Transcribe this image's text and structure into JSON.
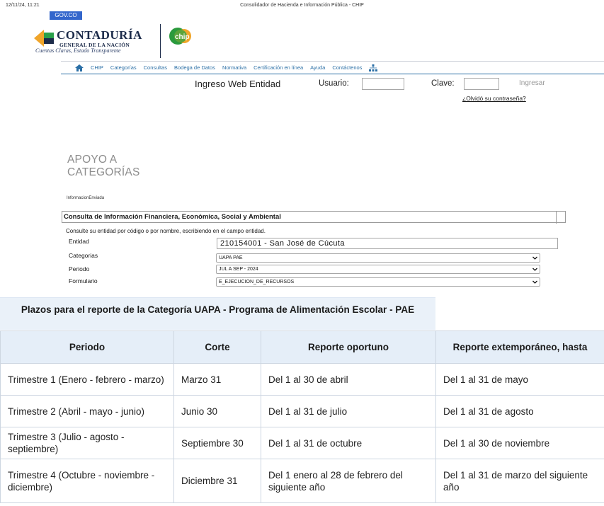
{
  "print_header": {
    "timestamp": "12/11/24, 11:21",
    "page_title": "Consolidador de Hacienda e Información Pública - CHIP"
  },
  "gov_badge": "GOV.CO",
  "logo": {
    "title": "CONTADURÍA",
    "subtitle": "GENERAL DE LA NACIÓN",
    "tagline": "Cuentas Claras, Estado Transparente",
    "chip_text": "chip"
  },
  "nav": {
    "items": [
      "CHIP",
      "Categorías",
      "Consultas",
      "Bodega de Datos",
      "Normativa",
      "Certificación en línea",
      "Ayuda",
      "Contáctenos"
    ],
    "icons": [
      "home-icon",
      "sitemap-icon"
    ],
    "color": "#2b6fa6"
  },
  "login": {
    "title": "Ingreso Web Entidad",
    "user_label": "Usuario:",
    "user_value": "",
    "pass_label": "Clave:",
    "pass_value": "",
    "submit_label": "Ingresar",
    "forgot_label": "¿Olvidó su contraseña?"
  },
  "section": {
    "title_line1": "APOYO A",
    "title_line2": "CATEGORÍAS",
    "info_label": "InformacionEnviada"
  },
  "form": {
    "header": "Consulta de Información Financiera, Económica, Social y Ambiental",
    "description": "Consulte su entidad por código o por nombre, escribiendo en el campo entidad.",
    "entidad_label": "Entidad",
    "entidad_value": "210154001 - San José de Cúcuta",
    "categorias_label": "Categorias",
    "categorias_value": "UAPA PAE",
    "periodo_label": "Periodo",
    "periodo_value": "JUL A SEP - 2024",
    "formulario_label": "Formulario",
    "formulario_value": "E_EJECUCION_DE_RECURSOS"
  },
  "plazos": {
    "title": "Plazos para el reporte de la Categoría UAPA - Programa de Alimentación Escolar - PAE",
    "headers": [
      "Periodo",
      "Corte",
      "Reporte oportuno",
      "Reporte extemporáneo, hasta"
    ],
    "rows": [
      [
        "Trimestre 1 (Enero - febrero - marzo)",
        "Marzo 31",
        "Del 1 al 30 de abril",
        "Del 1 al 31 de mayo"
      ],
      [
        "Trimestre 2 (Abril - mayo - junio)",
        "Junio 30",
        "Del 1 al 31 de julio",
        "Del 1 al 31 de agosto"
      ],
      [
        "Trimestre 3 (Julio - agosto - septiembre)",
        "Septiembre 30",
        "Del 1 al 31 de octubre",
        "Del 1 al 30 de noviembre"
      ],
      [
        "Trimestre 4 (Octubre - noviembre - diciembre)",
        "Diciembre 31",
        "Del 1 enero al 28 de febrero del siguiente año",
        "Del 1 al 31 de marzo del siguiente año"
      ]
    ],
    "header_bg": "#e5eef8"
  }
}
